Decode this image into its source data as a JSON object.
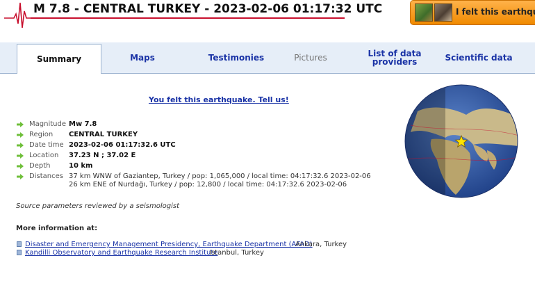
{
  "header": {
    "title": "M 7.8 - CENTRAL TURKEY - 2023-02-06 01:17:32 UTC",
    "felt_button_label": "I felt this earthquake"
  },
  "tabs": [
    {
      "label": "Summary",
      "active": true
    },
    {
      "label": "Maps"
    },
    {
      "label": "Testimonies"
    },
    {
      "label": "Pictures",
      "disabled": true
    },
    {
      "label": "List of data providers"
    },
    {
      "label": "Scientific data"
    }
  ],
  "main": {
    "felt_link": "You felt this earthquake. Tell us!",
    "params": [
      {
        "label": "Magnitude",
        "value": "Mw 7.8"
      },
      {
        "label": "Region",
        "value": "CENTRAL TURKEY"
      },
      {
        "label": "Date time",
        "value": "2023-02-06 01:17:32.6 UTC"
      },
      {
        "label": "Location",
        "value": "37.23 N ; 37.02 E"
      },
      {
        "label": "Depth",
        "value": "10 km"
      }
    ],
    "distances_label": "Distances",
    "distances": [
      "37 km WNW of Gaziantep, Turkey / pop: 1,065,000 / local time: 04:17:32.6 2023-02-06",
      "26 km ENE of Nurdağı, Turkey / pop: 12,800 / local time: 04:17:32.6 2023-02-06"
    ],
    "reviewed_note": "Source parameters reviewed by a seismologist",
    "more_info_title": "More information at:",
    "more_info": [
      {
        "link": "Disaster and Emergency Management Presidency, Earthquake Department (AFAD)",
        "text": " Ankara, Turkey"
      },
      {
        "link": "Kandilli Observatory and Earthquake Research Institute",
        "text": " Istanbul, Turkey"
      }
    ]
  },
  "colors": {
    "accent_link": "#1a33a6",
    "title_underline": "#c8102e",
    "button_orange": "#f08a00",
    "arrow_green": "#6fbf3a",
    "tab_bar": "#e6eef8"
  },
  "icons": [
    "seismogram-icon",
    "felt-photo-icon",
    "arrow-right-icon",
    "list-bullet-icon",
    "earthquake-star-icon"
  ]
}
